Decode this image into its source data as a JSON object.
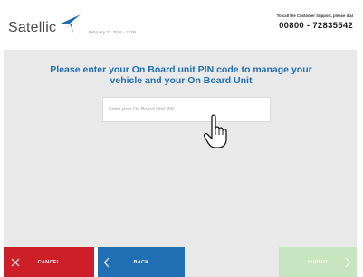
{
  "header": {
    "logo_text": "Satellic",
    "date": "February 23, 2016 - 13:06",
    "support_label": "To call the Customer Support, please dial",
    "support_phone": "00800 - 72835542"
  },
  "main": {
    "title": "Please enter your On Board unit PIN code to manage your vehicle and your On Board Unit",
    "pin_placeholder": "Enter your On Board Unit PIN"
  },
  "footer": {
    "cancel_label": "CANCEL",
    "back_label": "BACK",
    "submit_label": "SUBMIT"
  },
  "colors": {
    "brand_blue": "#1f6fb2",
    "cancel_red": "#cc1f27",
    "submit_disabled_green": "#c7e6bf",
    "logo_green": "#7bbf3a"
  },
  "icons": {
    "cancel": "close-icon",
    "back": "chevron-left-icon",
    "submit": "chevron-right-icon",
    "pointer": "hand-pointer-icon"
  }
}
